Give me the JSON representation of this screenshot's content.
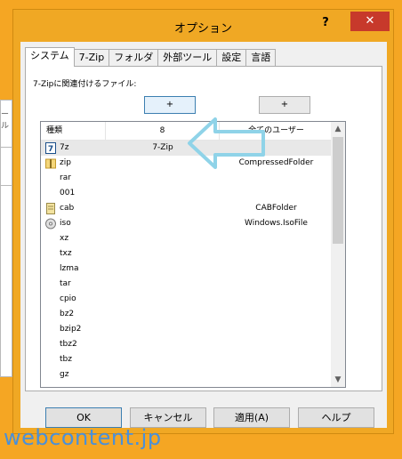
{
  "window": {
    "title": "オプション",
    "help_glyph": "?",
    "close_glyph": "✕"
  },
  "background_fragment": "ール",
  "tabs": [
    "システム",
    "7-Zip",
    "フォルダ",
    "外部ツール",
    "設定",
    "言語"
  ],
  "active_tab": "システム",
  "assoc_label": "7-Zipに関連付けるファイル:",
  "plus_buttons": [
    "+",
    "+"
  ],
  "columns": [
    "種類",
    "8",
    "全てのユーザー"
  ],
  "rows": [
    {
      "type": "7z",
      "col2": "7-Zip",
      "col3": "",
      "icon": "7z-archive-icon",
      "selected": true
    },
    {
      "type": "zip",
      "col2": "",
      "col3": "CompressedFolder",
      "icon": "zip-folder-icon"
    },
    {
      "type": "rar",
      "col2": "",
      "col3": ""
    },
    {
      "type": "001",
      "col2": "",
      "col3": ""
    },
    {
      "type": "cab",
      "col2": "",
      "col3": "CABFolder",
      "icon": "cab-file-icon"
    },
    {
      "type": "iso",
      "col2": "",
      "col3": "Windows.IsoFile",
      "icon": "disc-image-icon"
    },
    {
      "type": "xz",
      "col2": "",
      "col3": ""
    },
    {
      "type": "txz",
      "col2": "",
      "col3": ""
    },
    {
      "type": "lzma",
      "col2": "",
      "col3": ""
    },
    {
      "type": "tar",
      "col2": "",
      "col3": ""
    },
    {
      "type": "cpio",
      "col2": "",
      "col3": ""
    },
    {
      "type": "bz2",
      "col2": "",
      "col3": ""
    },
    {
      "type": "bzip2",
      "col2": "",
      "col3": ""
    },
    {
      "type": "tbz2",
      "col2": "",
      "col3": ""
    },
    {
      "type": "tbz",
      "col2": "",
      "col3": ""
    },
    {
      "type": "gz",
      "col2": "",
      "col3": ""
    }
  ],
  "buttons": {
    "ok": "OK",
    "cancel": "キャンセル",
    "apply": "適用(A)",
    "help": "ヘルプ"
  },
  "watermark": "webcontent.jp",
  "colors": {
    "accent": "#f0a824",
    "close": "#c7392b",
    "arrow": "#8fd3e8"
  }
}
